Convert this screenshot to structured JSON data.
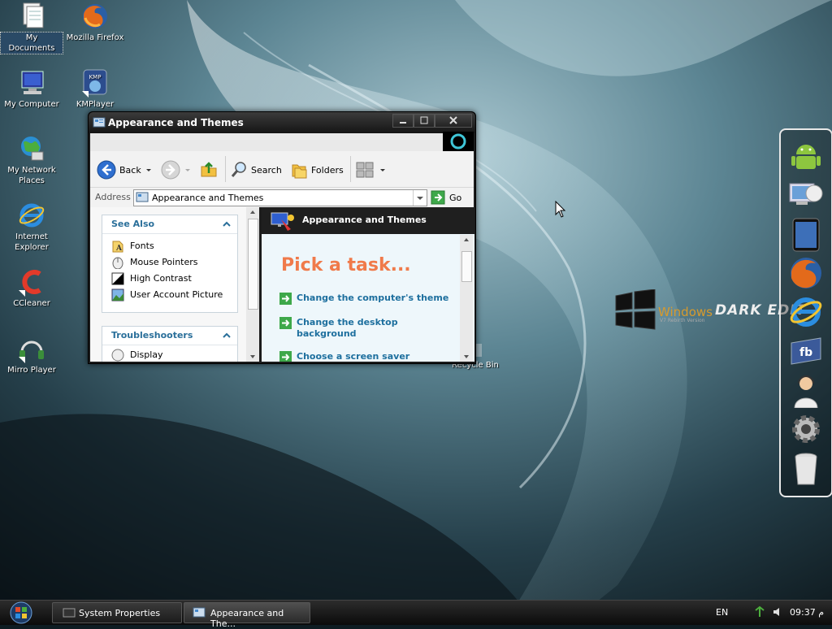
{
  "desktop": {
    "icons": [
      {
        "label": "My Documents",
        "icon": "documents-icon"
      },
      {
        "label": "Mozilla Firefox",
        "icon": "firefox-icon"
      },
      {
        "label": "My Computer",
        "icon": "computer-icon"
      },
      {
        "label": "KMPlayer",
        "icon": "kmplayer-icon"
      },
      {
        "label": "My Network Places",
        "icon": "network-icon"
      },
      {
        "label": "Internet Explorer",
        "icon": "ie-icon"
      },
      {
        "label": "CCleaner",
        "icon": "ccleaner-icon"
      },
      {
        "label": "Mirro Player",
        "icon": "mirro-player-icon"
      },
      {
        "label": "Recycle Bin",
        "icon": "recycle-bin-icon"
      }
    ],
    "logo": {
      "windows": "Windows",
      "edition": "DARK EDIT",
      "sub": "V7 Rebirth Version"
    }
  },
  "window": {
    "title": "Appearance and Themes",
    "toolbar": {
      "back": "Back",
      "search": "Search",
      "folders": "Folders"
    },
    "address": {
      "label": "Address",
      "value": "Appearance and Themes",
      "go": "Go"
    },
    "see_also": {
      "title": "See Also",
      "items": [
        "Fonts",
        "Mouse Pointers",
        "High Contrast",
        "User Account Picture"
      ]
    },
    "troubleshooters": {
      "title": "Troubleshooters",
      "items": [
        "Display"
      ]
    },
    "content": {
      "header": "Appearance and Themes",
      "pick_task": "Pick a task...",
      "tasks": [
        "Change the computer's theme",
        "Change the desktop background",
        "Choose a screen saver"
      ]
    }
  },
  "dock": {
    "items": [
      "android-icon",
      "display-settings-icon",
      "tablet-icon",
      "firefox-icon",
      "ie-icon",
      "facebook-icon",
      "user-support-icon",
      "gear-icon",
      "trash-icon"
    ]
  },
  "taskbar": {
    "buttons": [
      {
        "label": "System Properties",
        "active": false
      },
      {
        "label": "Appearance and The...",
        "active": true
      }
    ],
    "tray": {
      "lang": "EN",
      "time": "09:37 م"
    }
  },
  "colors": {
    "accent_link": "#1d6f9e",
    "pick_task": "#f07a4a",
    "logo_orange": "#d79a2d"
  }
}
